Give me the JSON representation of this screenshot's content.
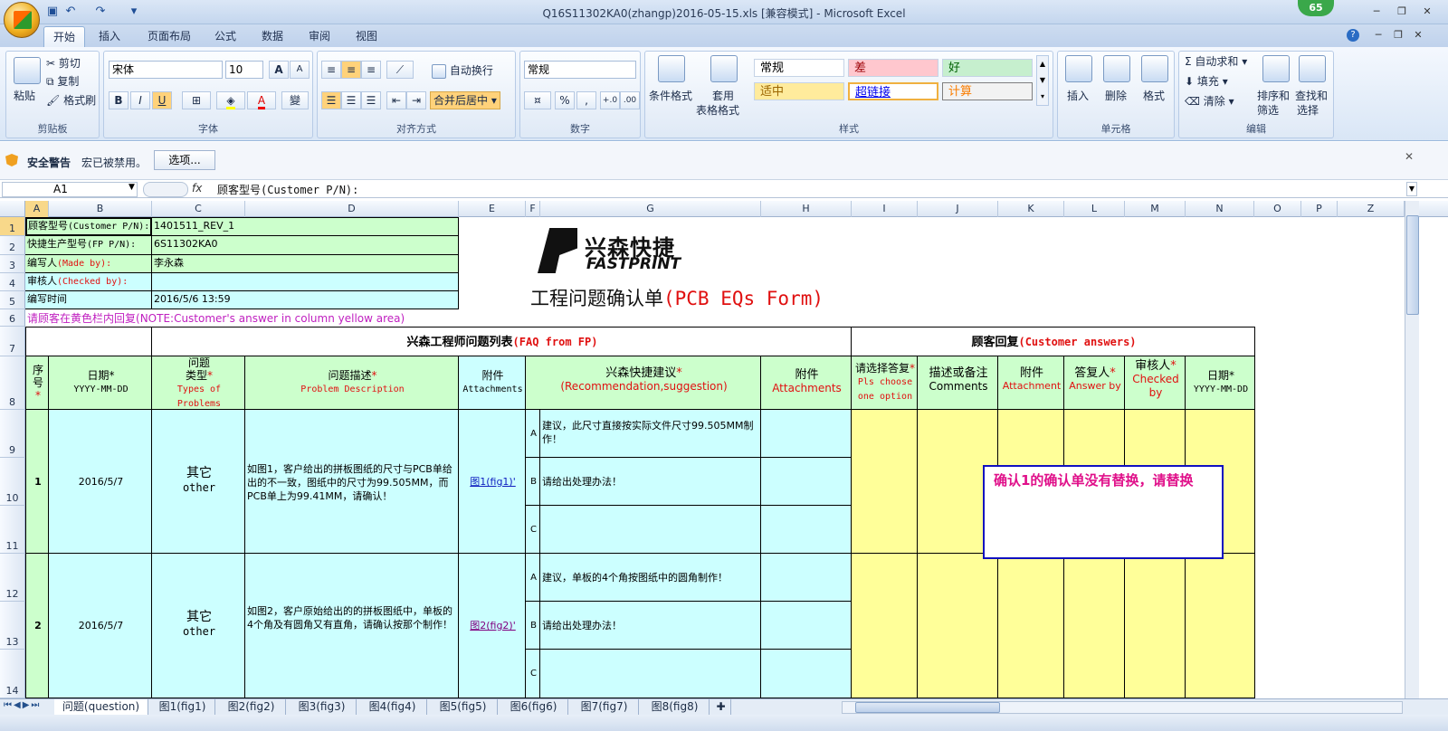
{
  "window": {
    "title": "Q16S11302KA0(zhangp)2016-05-15.xls  [兼容模式] - Microsoft Excel",
    "badge": "65"
  },
  "ribbon_tabs": [
    "开始",
    "插入",
    "页面布局",
    "公式",
    "数据",
    "审阅",
    "视图"
  ],
  "ribbon": {
    "clipboard": {
      "paste": "粘贴",
      "cut": "剪切",
      "copy": "复制",
      "format_painter": "格式刷",
      "label": "剪贴板"
    },
    "font": {
      "name": "宋体",
      "size": "10",
      "label": "字体",
      "bold": "B",
      "italic": "I",
      "underline": "U",
      "grow": "A",
      "shrink": "A",
      "phonetic": "變"
    },
    "alignment": {
      "wrap": "自动换行",
      "merge": "合并后居中",
      "label": "对齐方式"
    },
    "number": {
      "format": "常规",
      "percent": "%",
      "comma": ",",
      "label": "数字"
    },
    "styles": {
      "cond_format": "条件格式",
      "table_format_1": "套用",
      "table_format_2": "表格格式",
      "cells": [
        "常规",
        "差",
        "好",
        "适中",
        "超链接",
        "计算"
      ],
      "label": "样式"
    },
    "cells": {
      "insert": "插入",
      "delete": "删除",
      "format": "格式",
      "label": "单元格"
    },
    "editing": {
      "autosum": "自动求和",
      "fill": "填充",
      "clear": "清除",
      "sort_1": "排序和",
      "sort_2": "筛选",
      "find_1": "查找和",
      "find_2": "选择",
      "label": "编辑"
    }
  },
  "security": {
    "title": "安全警告",
    "message": "宏已被禁用。",
    "options": "选项..."
  },
  "formula": {
    "cell_ref": "A1",
    "fx": "fx",
    "content": "顾客型号(Customer P/N):"
  },
  "columns": [
    "A",
    "B",
    "C",
    "D",
    "E",
    "F",
    "G",
    "H",
    "I",
    "J",
    "K",
    "L",
    "M",
    "N",
    "O",
    "P",
    "Z"
  ],
  "rows": [
    "1",
    "2",
    "3",
    "4",
    "5",
    "6",
    "7",
    "8",
    "9",
    "10",
    "11",
    "12",
    "13",
    "14"
  ],
  "info": [
    {
      "label_cn": "顾客型号",
      "label_en": "(Customer P/N):",
      "value": "1401511_REV_1"
    },
    {
      "label_cn": "快捷生产型号",
      "label_en": "(FP P/N):",
      "value": "6S11302KA0"
    },
    {
      "label_cn": "编写人",
      "label_en": "(Made by):",
      "value": "李永森"
    },
    {
      "label_cn": "审核人",
      "label_en": "(Checked by):",
      "value": ""
    },
    {
      "label_cn": "编写时间",
      "label_en": "",
      "value": "2016/5/6 13:59"
    }
  ],
  "logo": {
    "cn": "兴森快捷",
    "en": "FASTPRINT"
  },
  "form_title": {
    "cn": "工程问题确认单",
    "en": "(PCB EQs Form)"
  },
  "note": {
    "cn": "请顾客在黄色栏内回复",
    "en": "(NOTE:Customer's answer in column yellow area)"
  },
  "section_headers": {
    "fp_cn": "兴森工程师问题列表",
    "fp_en": "(FAQ from FP)",
    "cust_cn": "顾客回复",
    "cust_en": "(Customer answers)"
  },
  "col_headers": {
    "seq": {
      "cn": "序号",
      "star": "*"
    },
    "date": {
      "cn": "日期*",
      "en": "YYYY-MM-DD"
    },
    "type": {
      "cn1": "问题",
      "cn2": "类型",
      "star": "*",
      "en": "Types of Problems"
    },
    "desc": {
      "cn": "问题描述",
      "star": "*",
      "en": "Problem Description"
    },
    "attach": {
      "cn": "附件",
      "en": "Attachments"
    },
    "rec": {
      "cn": "兴森快捷建议",
      "star": "*",
      "en": "(Recommendation,suggestion)"
    },
    "attach2": {
      "cn": "附件",
      "en": "Attachments"
    },
    "choose": {
      "cn": "请选择答复",
      "star": "*",
      "en": "Pls choose one option"
    },
    "comments": {
      "cn": "描述或备注",
      "en": "Comments"
    },
    "attach3": {
      "cn": "附件",
      "en": "Attachment"
    },
    "answer": {
      "cn": "答复人",
      "star": "*",
      "en": "Answer by"
    },
    "checked": {
      "cn": "审核人",
      "star": "*",
      "en": "Checked by"
    },
    "date2": {
      "cn": "日期*",
      "en": "YYYY-MM-DD"
    }
  },
  "problems": [
    {
      "no": "1",
      "date": "2016/5/7",
      "type_cn": "其它",
      "type_en": "other",
      "desc": "如图1，客户给出的拼板图纸的尺寸与PCB单给出的不一致，图纸中的尺寸为99.505MM，而PCB单上为99.41MM，请确认！",
      "attach": "图1(fig1)'",
      "options": [
        {
          "key": "A",
          "text": "建议，此尺寸直接按实际文件尺寸99.505MM制作！"
        },
        {
          "key": "B",
          "text": "请给出处理办法！"
        },
        {
          "key": "C",
          "text": ""
        }
      ]
    },
    {
      "no": "2",
      "date": "2016/5/7",
      "type_cn": "其它",
      "type_en": "other",
      "desc": "如图2，客户原始给出的的拼板图纸中，单板的4个角及有圆角又有直角，请确认按那个制作！",
      "attach": "图2(fig2)'",
      "options": [
        {
          "key": "A",
          "text": "建议，单板的4个角按图纸中的圆角制作！"
        },
        {
          "key": "B",
          "text": "请给出处理办法！"
        },
        {
          "key": "C",
          "text": ""
        }
      ]
    }
  ],
  "callout": "确认1的确认单没有替换，请替换",
  "sheet_tabs": [
    "问题(question)",
    "图1(fig1)",
    "图2(fig2)",
    "图3(fig3)",
    "图4(fig4)",
    "图5(fig5)",
    "图6(fig6)",
    "图7(fig7)",
    "图8(fig8)"
  ]
}
